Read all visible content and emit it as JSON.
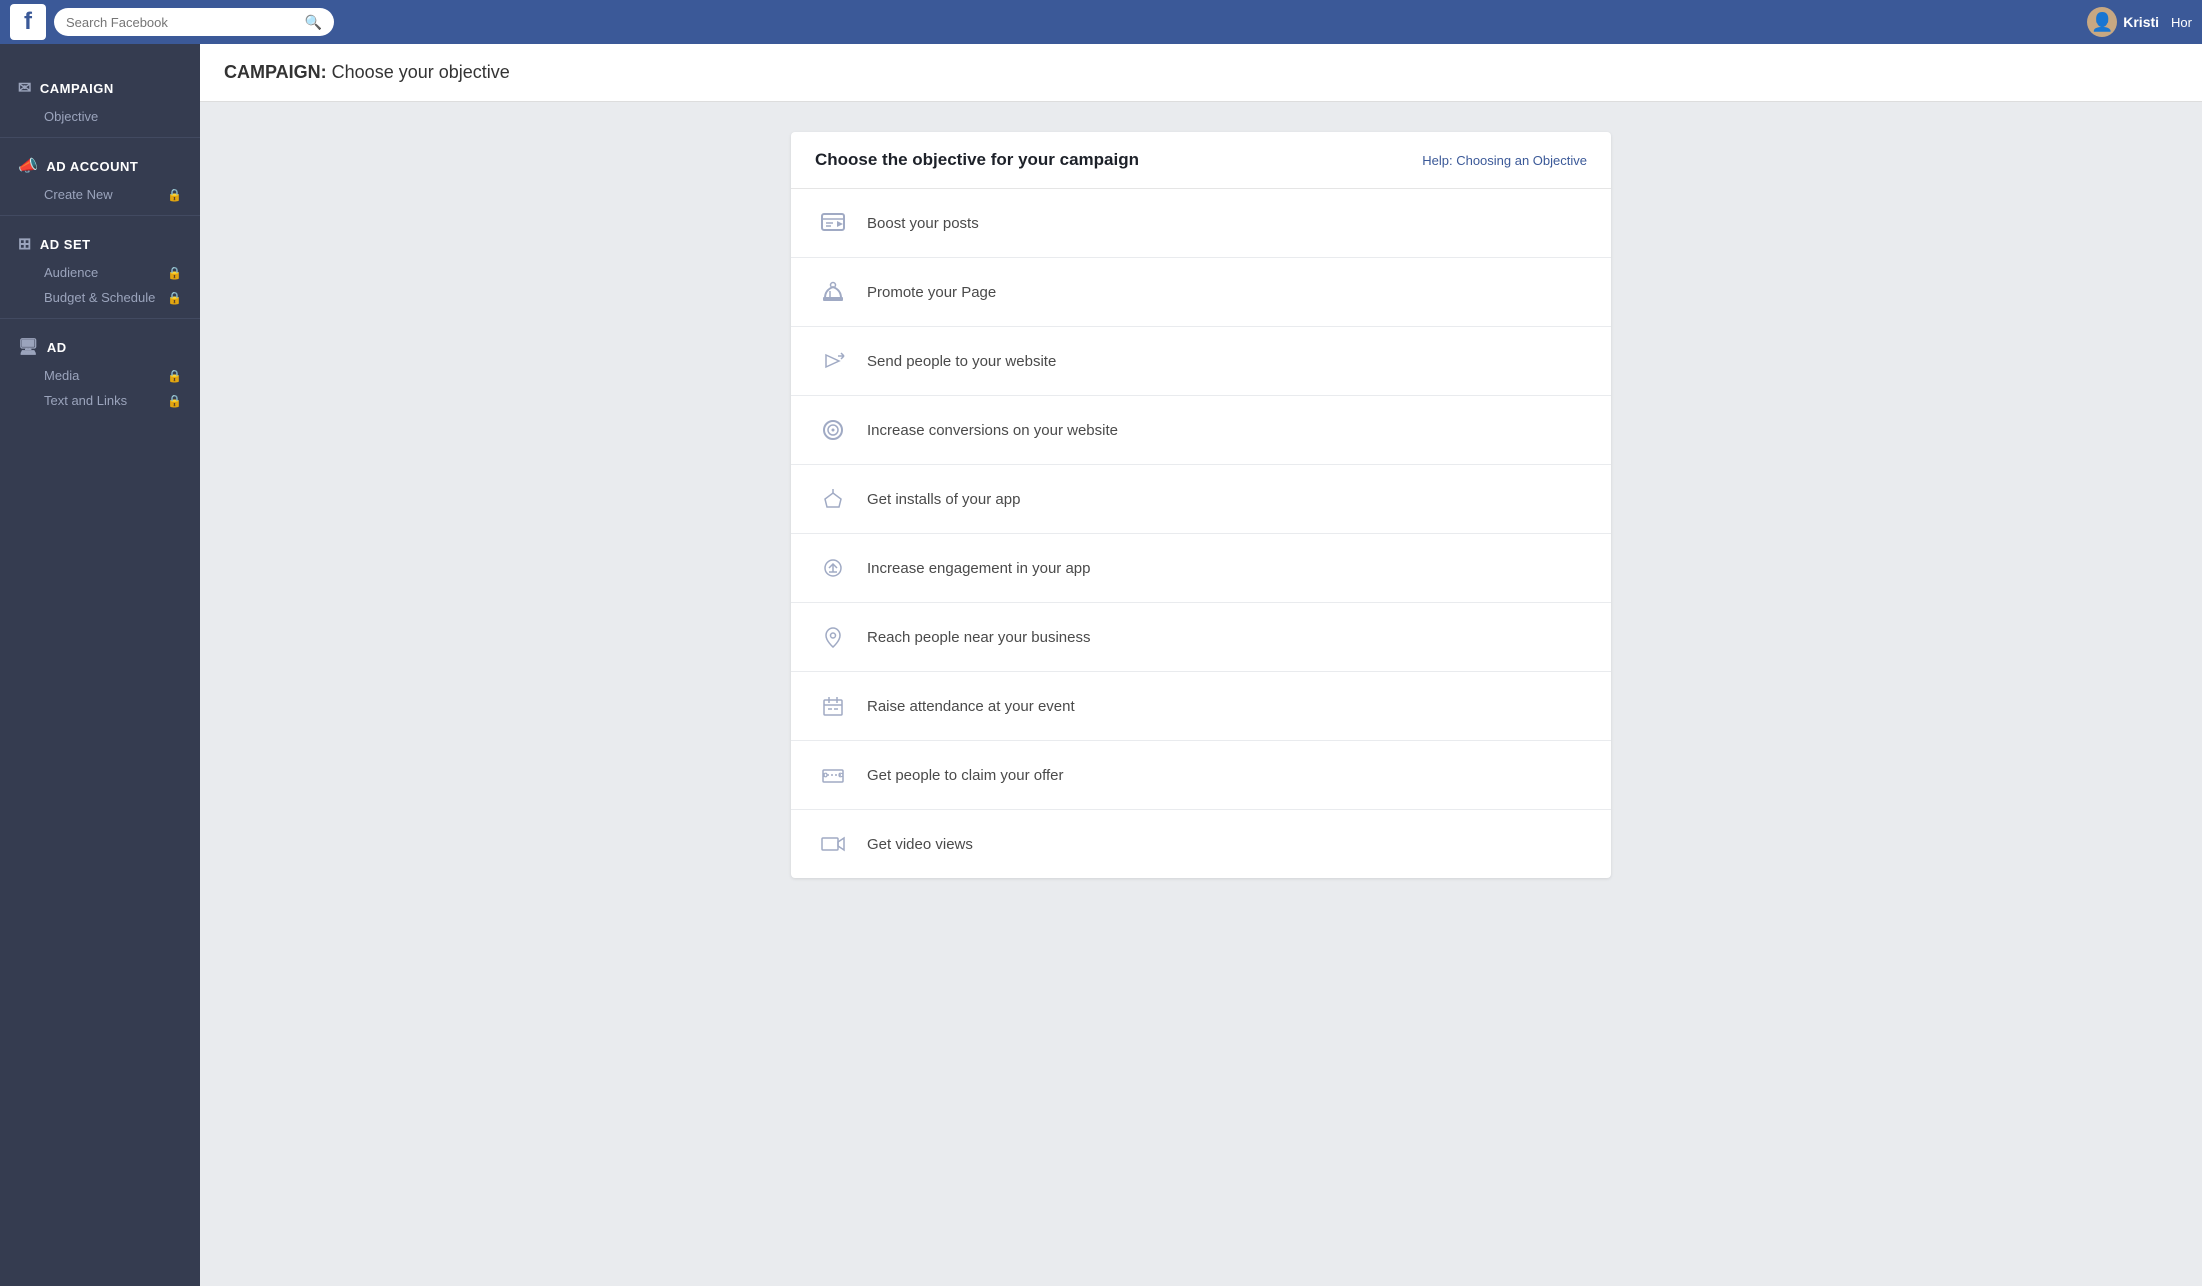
{
  "topNav": {
    "logo": "f",
    "searchPlaceholder": "Search Facebook",
    "userName": "Kristi",
    "homeLabel": "Hor"
  },
  "pageHeader": {
    "boldPart": "CAMPAIGN:",
    "rest": " Choose your objective"
  },
  "sidebar": {
    "sections": [
      {
        "id": "campaign",
        "iconSymbol": "✉",
        "headerLabel": "CAMPAIGN",
        "items": [
          {
            "label": "Objective",
            "locked": false
          }
        ]
      },
      {
        "id": "adAccount",
        "iconSymbol": "📣",
        "headerLabel": "AD ACCOUNT",
        "items": [
          {
            "label": "Create New",
            "locked": true
          }
        ]
      },
      {
        "id": "adSet",
        "iconSymbol": "⊞",
        "headerLabel": "AD SET",
        "items": [
          {
            "label": "Audience",
            "locked": true
          },
          {
            "label": "Budget & Schedule",
            "locked": true
          }
        ]
      },
      {
        "id": "ad",
        "iconSymbol": "🖥",
        "headerLabel": "AD",
        "items": [
          {
            "label": "Media",
            "locked": true
          },
          {
            "label": "Text and Links",
            "locked": true
          }
        ]
      }
    ]
  },
  "objectiveCard": {
    "title": "Choose the objective for your campaign",
    "helpLabel": "Help: Choosing an Objective",
    "objectives": [
      {
        "id": "boost-posts",
        "label": "Boost your posts",
        "icon": "🗨"
      },
      {
        "id": "promote-page",
        "label": "Promote your Page",
        "icon": "👍"
      },
      {
        "id": "send-to-website",
        "label": "Send people to your website",
        "icon": "↗"
      },
      {
        "id": "increase-conversions",
        "label": "Increase conversions on your website",
        "icon": "🌐"
      },
      {
        "id": "get-installs",
        "label": "Get installs of your app",
        "icon": "📦"
      },
      {
        "id": "increase-engagement",
        "label": "Increase engagement in your app",
        "icon": "🎮"
      },
      {
        "id": "reach-people",
        "label": "Reach people near your business",
        "icon": "📍"
      },
      {
        "id": "raise-attendance",
        "label": "Raise attendance at your event",
        "icon": "📅"
      },
      {
        "id": "claim-offer",
        "label": "Get people to claim your offer",
        "icon": "🏷"
      },
      {
        "id": "video-views",
        "label": "Get video views",
        "icon": "🎬"
      }
    ]
  }
}
